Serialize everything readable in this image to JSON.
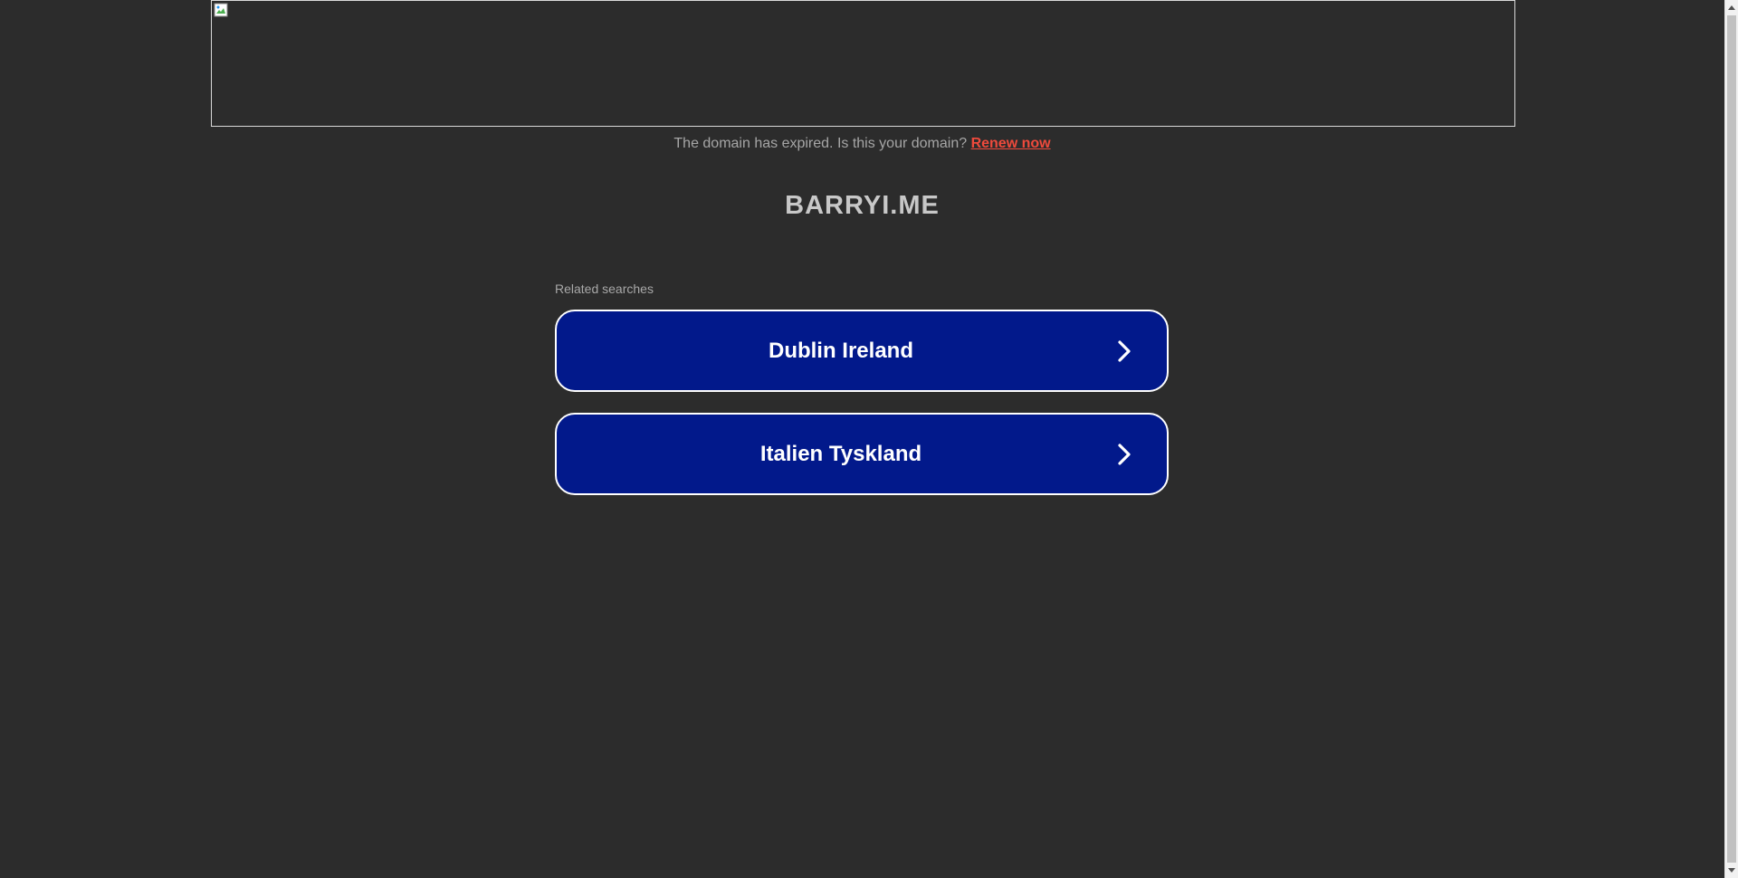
{
  "banner": {
    "image_state": "broken-image"
  },
  "notice": {
    "text": "The domain has expired. Is this your domain?",
    "link_label": "Renew now"
  },
  "domain": {
    "name": "BARRYI.ME"
  },
  "related": {
    "heading": "Related searches",
    "items": [
      {
        "label": "Dublin Ireland",
        "icon": "chevron-right-icon"
      },
      {
        "label": "Italien Tyskland",
        "icon": "chevron-right-icon"
      }
    ]
  },
  "colors": {
    "background": "#2c2c2c",
    "button": "#02198b",
    "link": "#ef4a3c",
    "title": "#c8c8c8"
  }
}
